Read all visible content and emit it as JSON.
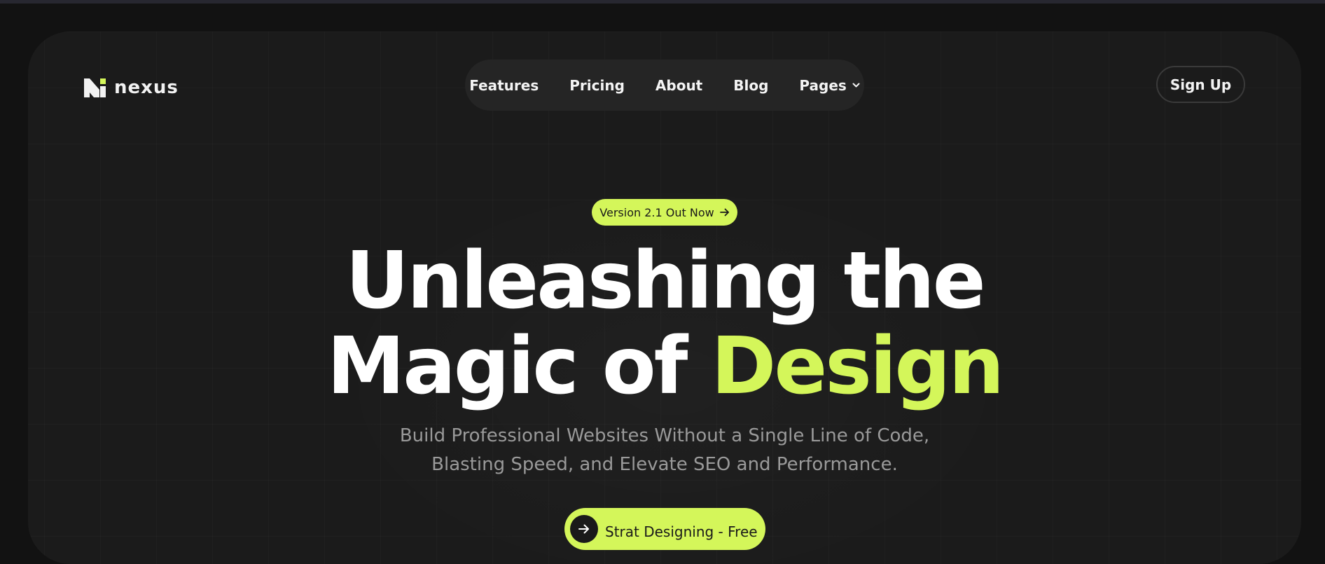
{
  "brand": {
    "name": "nexus",
    "logo_icon": "nexus-n-logo-icon"
  },
  "nav": {
    "items": [
      {
        "label": "Features"
      },
      {
        "label": "Pricing"
      },
      {
        "label": "About"
      },
      {
        "label": "Blog"
      },
      {
        "label": "Pages",
        "icon": "chevron-down-icon"
      }
    ]
  },
  "header": {
    "signup_label": "Sign Up"
  },
  "hero": {
    "badge_label": "Version 2.1 Out Now",
    "badge_icon": "arrow-right-icon",
    "title_line1": "Unleashing the",
    "title_line2_plain": "Magic of ",
    "title_line2_accent": "Design",
    "subtitle_line1": "Build Professional Websites Without a Single Line of Code,",
    "subtitle_line2": "Blasting Speed, and Elevate SEO and Performance.",
    "cta_label": "Strat Designing - Free",
    "cta_icon": "arrow-right-icon"
  },
  "colors": {
    "accent": "#d4f65a",
    "background": "#121212",
    "panel": "#1b1b1b",
    "nav_pill": "#252525",
    "text": "#ffffff",
    "muted_text": "#9a9a9a"
  }
}
